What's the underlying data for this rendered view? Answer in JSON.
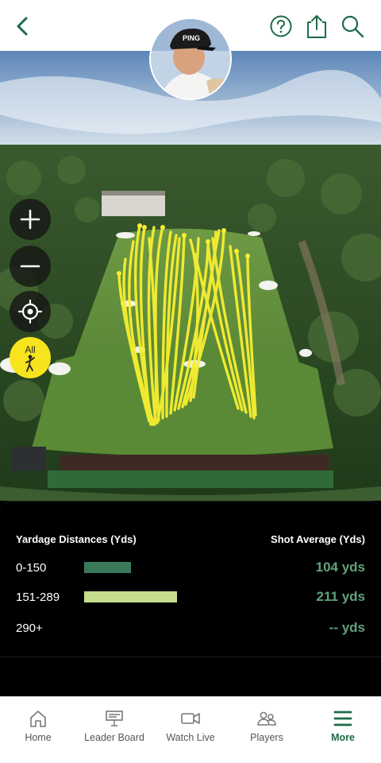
{
  "header": {
    "back_icon": "chevron-left-icon",
    "help_icon": "question-circle-icon",
    "share_icon": "share-icon",
    "search_icon": "search-icon",
    "accent_color": "#1c6b47",
    "avatar_cap_text": "PING"
  },
  "map_controls": {
    "zoom_in_icon": "plus-icon",
    "zoom_out_icon": "minus-icon",
    "locate_icon": "crosshair-icon",
    "filter_label": "All",
    "filter_icon": "golfer-icon"
  },
  "stats": {
    "left_header": "Yardage Distances (Yds)",
    "right_header": "Shot Average (Yds)",
    "rows": [
      {
        "range": "0-150",
        "average": "104 yds",
        "bar_color": "#3a7a5a",
        "bar_fraction": 0.5
      },
      {
        "range": "151-289",
        "average": "211 yds",
        "bar_color": "#c5dd8c",
        "bar_fraction": 1.0
      },
      {
        "range": "290+",
        "average": "-- yds",
        "bar_color": "",
        "bar_fraction": 0
      }
    ]
  },
  "nav": {
    "items": [
      {
        "label": "Home",
        "icon": "home-icon",
        "active": false
      },
      {
        "label": "Leader Board",
        "icon": "leaderboard-icon",
        "active": false
      },
      {
        "label": "Watch Live",
        "icon": "video-camera-icon",
        "active": false
      },
      {
        "label": "Players",
        "icon": "players-icon",
        "active": false
      },
      {
        "label": "More",
        "icon": "menu-icon",
        "active": true
      }
    ]
  }
}
